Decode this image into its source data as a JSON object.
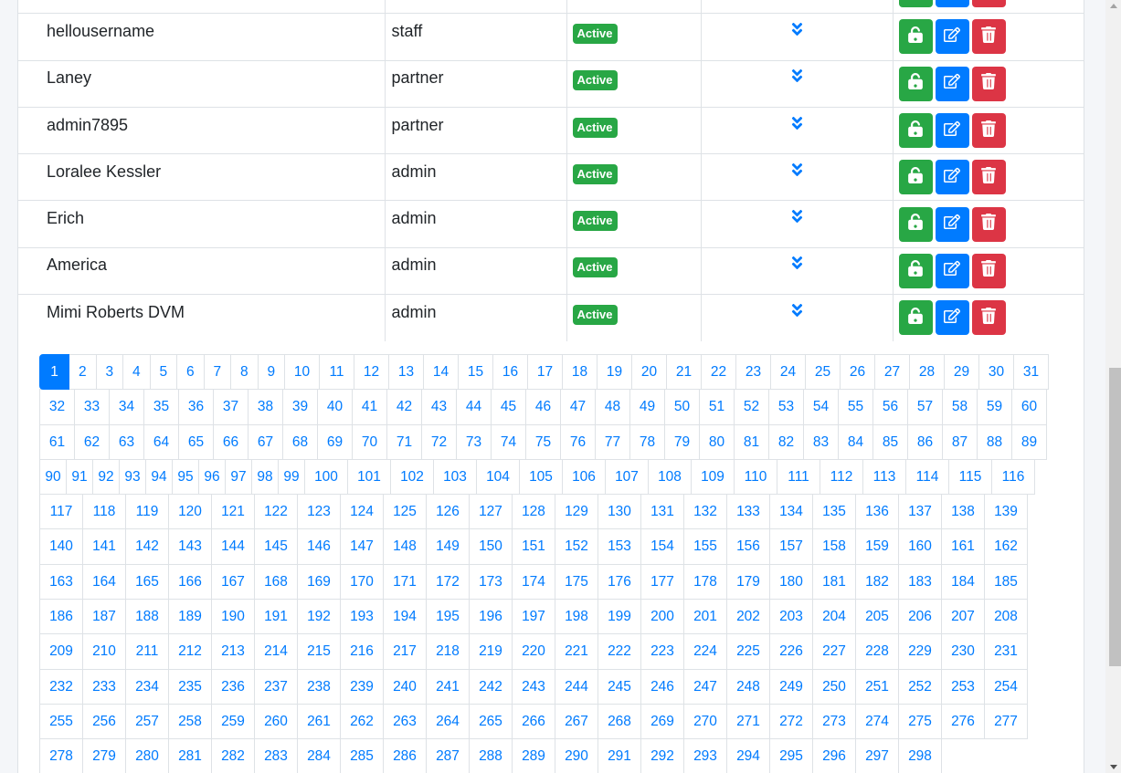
{
  "rows": [
    {
      "name": "",
      "role": "",
      "status": "",
      "show_status": false
    },
    {
      "name": "hellousername",
      "role": "staff",
      "status": "Active",
      "show_status": true
    },
    {
      "name": "Laney",
      "role": "partner",
      "status": "Active",
      "show_status": true
    },
    {
      "name": "admin7895",
      "role": "partner",
      "status": "Active",
      "show_status": true
    },
    {
      "name": "Loralee Kessler",
      "role": "admin",
      "status": "Active",
      "show_status": true
    },
    {
      "name": "Erich",
      "role": "admin",
      "status": "Active",
      "show_status": true
    },
    {
      "name": "America",
      "role": "admin",
      "status": "Active",
      "show_status": true
    },
    {
      "name": "Mimi Roberts DVM",
      "role": "admin",
      "status": "Active",
      "show_status": true
    }
  ],
  "actions": {
    "unlock_icon": "unlock-icon",
    "edit_icon": "edit-icon",
    "delete_icon": "trash-icon",
    "expand_icon": "chevron-double-down-icon"
  },
  "colors": {
    "primary": "#007bff",
    "success": "#28a745",
    "danger": "#dc3545"
  },
  "pagination": {
    "current_page": 1,
    "first_page": 1,
    "last_visible_page": 298
  }
}
